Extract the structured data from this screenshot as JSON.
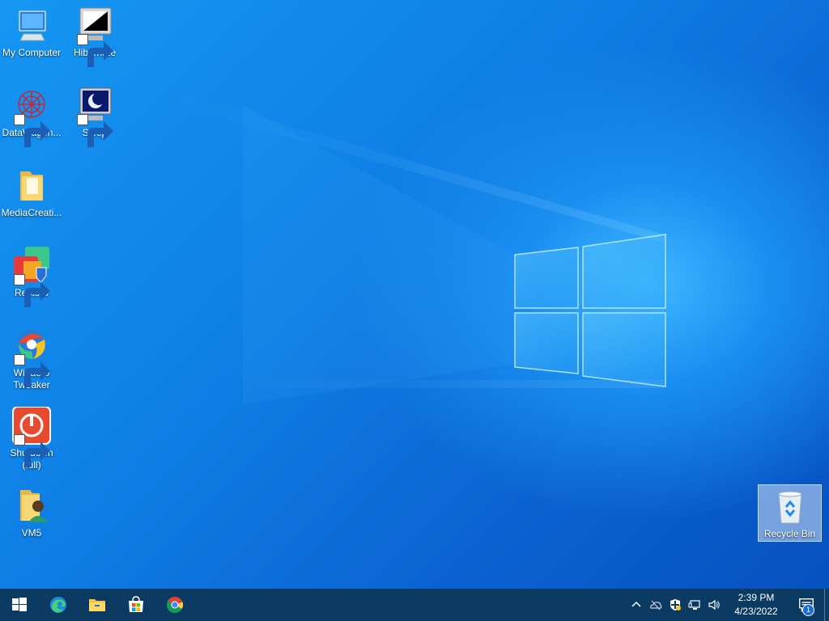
{
  "desktop": {
    "icons": [
      {
        "label": "My Computer",
        "icon": "computer-icon"
      },
      {
        "label": "Hibernate",
        "icon": "hibernate-icon"
      },
      {
        "label": "DataWagon...",
        "icon": "datawagon-icon"
      },
      {
        "label": "Sleep",
        "icon": "sleep-icon"
      },
      {
        "label": "MediaCreati...",
        "icon": "folder-icon"
      },
      {
        "label": "Restoro",
        "icon": "restoro-icon"
      },
      {
        "label": "Winaero Tweaker",
        "icon": "winaero-tweaker-icon"
      },
      {
        "label": "Shutdown (full)",
        "icon": "shutdown-icon"
      },
      {
        "label": "VM5",
        "icon": "user-folder-icon"
      },
      {
        "label": "Recycle Bin",
        "icon": "recycle-bin-icon"
      }
    ]
  },
  "taskbar": {
    "pinned": [
      "start-icon",
      "edge-icon",
      "file-explorer-icon",
      "store-icon",
      "chrome-icon"
    ],
    "tray": [
      "chevron-up-icon",
      "onedrive-offline-icon",
      "security-icon",
      "network-icon",
      "volume-icon"
    ],
    "time": "2:39 PM",
    "date": "4/23/2022",
    "notification_count": "1"
  },
  "colors": {
    "taskbar": "#0b3a63",
    "desktop_blue": "#1287ec"
  }
}
